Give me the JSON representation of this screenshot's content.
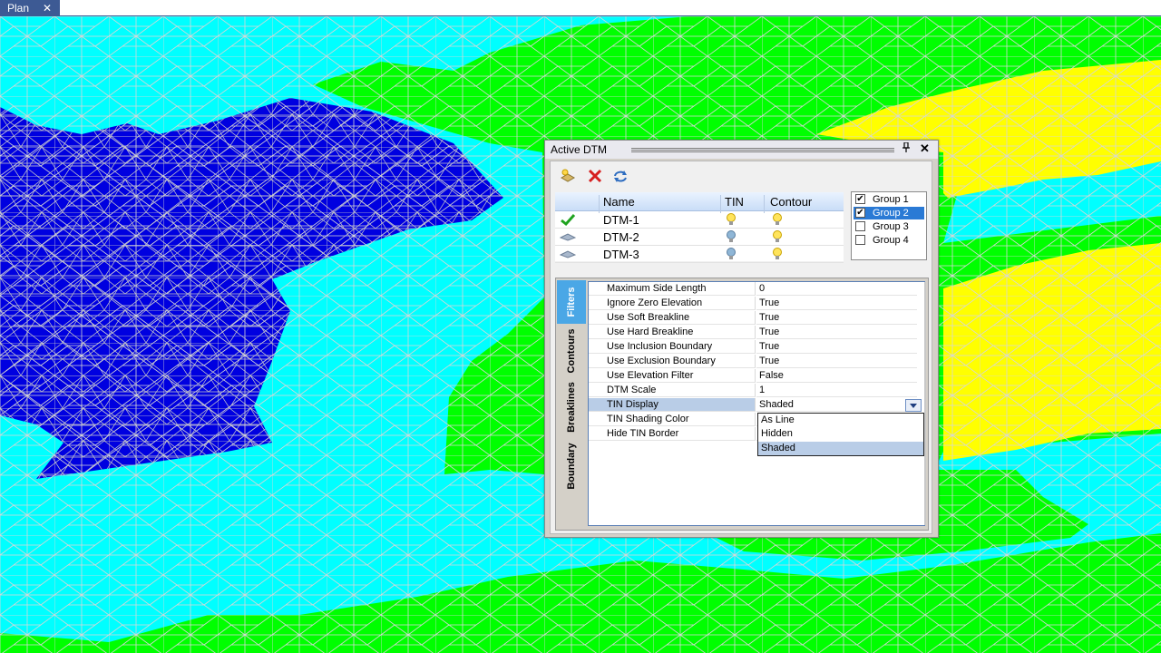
{
  "tab": {
    "label": "Plan",
    "close_glyph": "✕"
  },
  "panel": {
    "title": "Active DTM",
    "pin_glyph": "🖈",
    "close_glyph": "✕",
    "toolbar": {
      "add_icon": "add-dtm-icon",
      "delete_icon": "delete-icon",
      "refresh_icon": "refresh-icon"
    },
    "dtm_list": {
      "headers": {
        "name": "Name",
        "tin": "TIN",
        "contour": "Contour"
      },
      "rows": [
        {
          "name": "DTM-1",
          "status_icon": "checkmark-icon",
          "tin_icon": "lightbulb-on-icon",
          "contour_icon": "lightbulb-on-icon"
        },
        {
          "name": "DTM-2",
          "status_icon": "surface-icon",
          "tin_icon": "lightbulb-off-icon",
          "contour_icon": "lightbulb-on-icon"
        },
        {
          "name": "DTM-3",
          "status_icon": "surface-icon",
          "tin_icon": "lightbulb-off-icon",
          "contour_icon": "lightbulb-on-icon"
        }
      ]
    },
    "groups": [
      {
        "label": "Group 1",
        "checked": true,
        "selected": false
      },
      {
        "label": "Group 2",
        "checked": true,
        "selected": true
      },
      {
        "label": "Group 3",
        "checked": false,
        "selected": false
      },
      {
        "label": "Group 4",
        "checked": false,
        "selected": false
      }
    ],
    "side_tabs": [
      "Filters",
      "Contours",
      "Breaklines",
      "Boundary"
    ],
    "properties": [
      {
        "name": "Maximum Side Length",
        "value": "0"
      },
      {
        "name": "Ignore Zero Elevation",
        "value": "True"
      },
      {
        "name": "Use Soft Breakline",
        "value": "True"
      },
      {
        "name": "Use Hard Breakline",
        "value": "True"
      },
      {
        "name": "Use Inclusion Boundary",
        "value": "True"
      },
      {
        "name": "Use Exclusion Boundary",
        "value": "True"
      },
      {
        "name": "Use Elevation Filter",
        "value": "False"
      },
      {
        "name": "DTM Scale",
        "value": "1"
      },
      {
        "name": "TIN Display",
        "value": "Shaded"
      },
      {
        "name": "TIN Shading Color",
        "value": ""
      },
      {
        "name": "Hide TIN Border",
        "value": ""
      }
    ],
    "dropdown_options": [
      "As Line",
      "Hidden",
      "Shaded"
    ],
    "dropdown_selected": "Shaded"
  },
  "colors": {
    "water": "#00ffff",
    "low_zone": "#0000e0",
    "mid_zone": "#00ff00",
    "high_zone": "#ffff00",
    "mesh": "#c8c8c8",
    "accent": "#3d5a94"
  }
}
